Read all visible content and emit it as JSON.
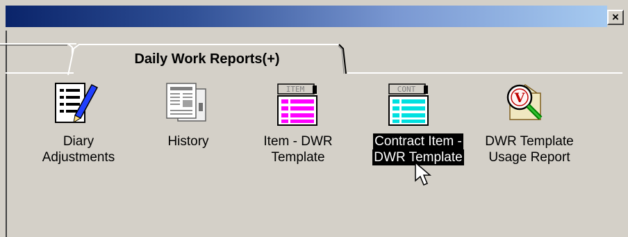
{
  "window": {
    "close_glyph": "×"
  },
  "tabs": {
    "active_label": "Daily Work Reports(+)"
  },
  "icons": [
    {
      "line1": "Diary",
      "line2": "Adjustments",
      "icon": "diary-edit-icon",
      "selected": false
    },
    {
      "line1": "History",
      "line2": "",
      "icon": "history-documents-icon",
      "selected": false
    },
    {
      "line1": "Item - DWR",
      "line2": "Template",
      "icon": "item-template-icon",
      "badge": "ITEM",
      "selected": false
    },
    {
      "line1": "Contract Item -",
      "line2": "DWR Template",
      "icon": "contract-template-icon",
      "badge": "CONT",
      "selected": true
    },
    {
      "line1": "DWR Template",
      "line2": "Usage Report",
      "icon": "usage-report-icon",
      "selected": false
    }
  ],
  "colors": {
    "item_accent": "#ff00ff",
    "cont_accent": "#00e0e0",
    "selection": "#000000"
  }
}
